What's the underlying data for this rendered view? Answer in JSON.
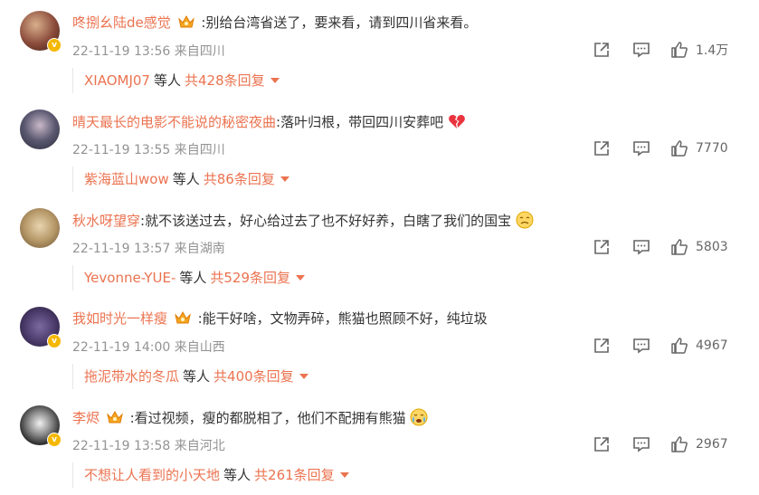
{
  "comments": [
    {
      "username": "咚捌幺陆de感觉",
      "has_crown": true,
      "text": ":别给台湾省送了，要来看，请到四川省来看。",
      "emoji": "",
      "meta": "22-11-19 13:56 来自四川",
      "likes": "1.4万",
      "verified": true,
      "reply_user": "XIAOMJ07",
      "reply_mid": "等人",
      "reply_count": "共428条回复",
      "avatar_color": "#8a4a3a"
    },
    {
      "username": "晴天最长的电影不能说的秘密夜曲",
      "has_crown": false,
      "text": ":落叶归根，带回四川安葬吧",
      "emoji": "broken-heart",
      "meta": "22-11-19 13:55 来自四川",
      "likes": "7770",
      "verified": false,
      "reply_user": "紫海蓝山wow",
      "reply_mid": "等人",
      "reply_count": "共86条回复",
      "avatar_color": "#5a5870"
    },
    {
      "username": "秋水呀望穿",
      "has_crown": false,
      "text": ":就不该送过去，好心给过去了也不好好养，白瞎了我们的国宝",
      "emoji": "sad-face",
      "meta": "22-11-19 13:57 来自湖南",
      "likes": "5803",
      "verified": false,
      "reply_user": "Yevonne-YUE-",
      "reply_mid": "等人",
      "reply_count": "共529条回复",
      "avatar_color": "#b89a6a"
    },
    {
      "username": "我如时光一样瘦",
      "has_crown": true,
      "text": ":能干好啥，文物弄碎，熊猫也照顾不好，纯垃圾",
      "emoji": "",
      "meta": "22-11-19 14:00 来自山西",
      "likes": "4967",
      "verified": true,
      "reply_user": "拖泥带水的冬瓜",
      "reply_mid": "等人",
      "reply_count": "共400条回复",
      "avatar_color": "#4a3a6a"
    },
    {
      "username": "李烬",
      "has_crown": true,
      "text": ":看过视频，瘦的都脱相了，他们不配拥有熊猫",
      "emoji": "crying-face",
      "meta": "22-11-19 13:58 来自河北",
      "likes": "2967",
      "verified": true,
      "reply_user": "不想让人看到的小天地",
      "reply_mid": "等人",
      "reply_count": "共261条回复",
      "avatar_color": "#222222"
    }
  ],
  "colors": {
    "accent": "#eb7350",
    "meta": "#939393"
  }
}
